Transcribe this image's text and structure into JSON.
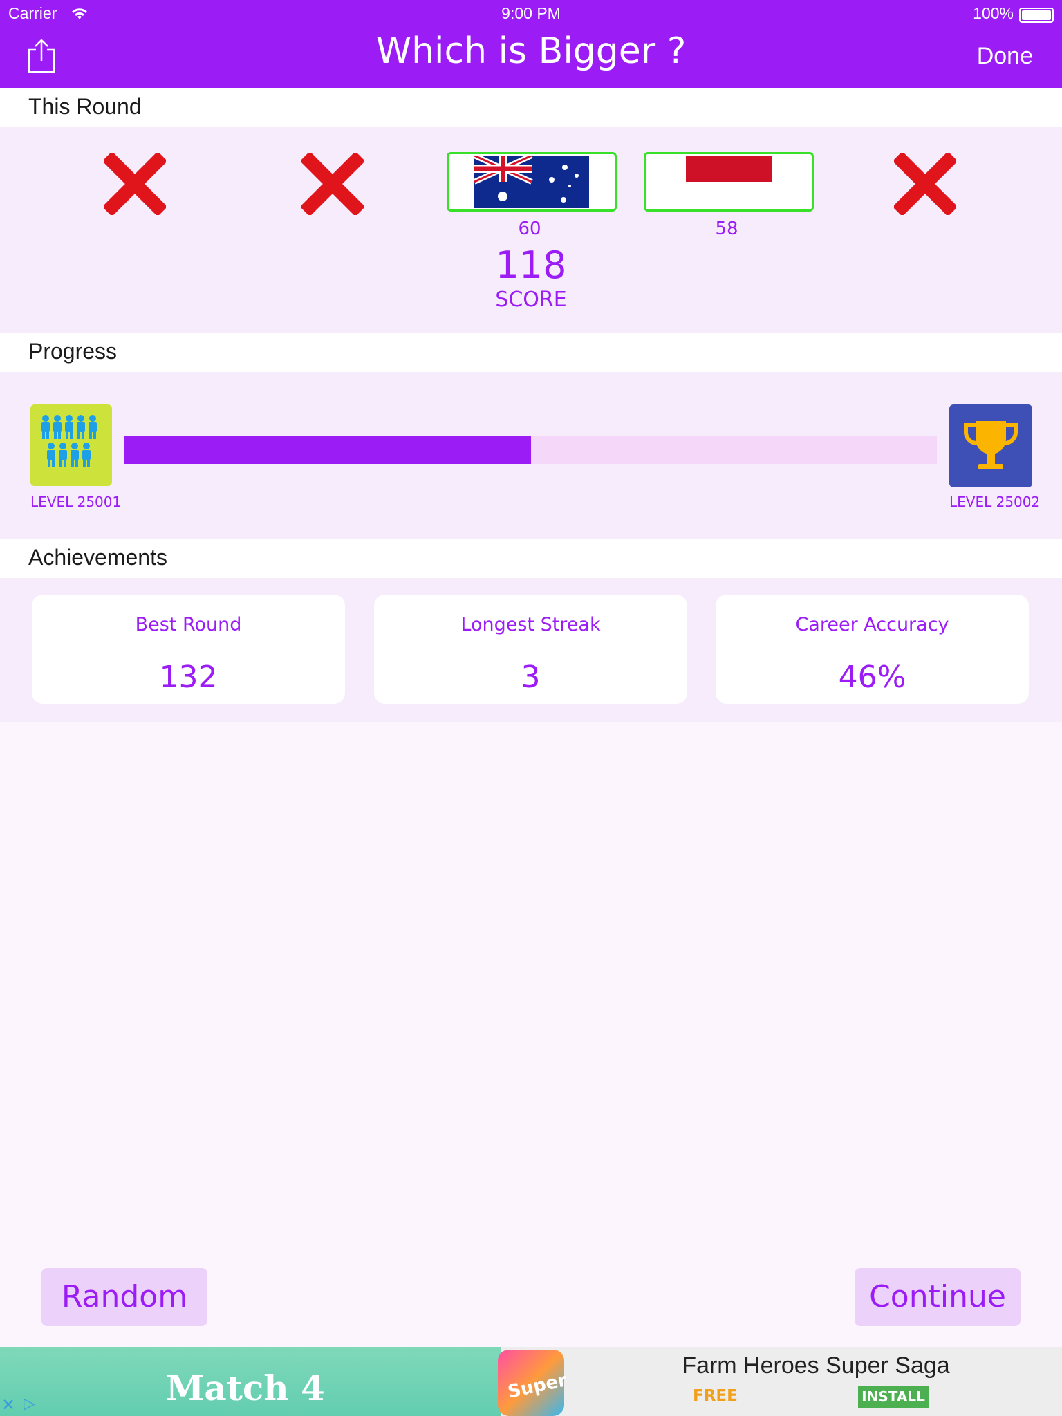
{
  "status_bar": {
    "carrier": "Carrier",
    "time": "9:00 PM",
    "battery": "100%"
  },
  "nav": {
    "title": "Which is Bigger ?",
    "done_label": "Done"
  },
  "this_round": {
    "heading": "This Round",
    "flags": [
      {
        "country": "Australia",
        "value": "60"
      },
      {
        "country": "Indonesia",
        "value": "58"
      }
    ],
    "score_value": "118",
    "score_label": "SCORE"
  },
  "progress": {
    "heading": "Progress",
    "current_level": "LEVEL 25001",
    "next_level": "LEVEL 25002",
    "fraction": 0.5
  },
  "achievements": {
    "heading": "Achievements",
    "cards": [
      {
        "title": "Best Round",
        "value": "132"
      },
      {
        "title": "Longest Streak",
        "value": "3"
      },
      {
        "title": "Career Accuracy",
        "value": "46%"
      }
    ]
  },
  "buttons": {
    "random": "Random",
    "continue": "Continue"
  },
  "ad": {
    "banner_text": "Match 4",
    "app_icon_text": "Super",
    "app_name": "Farm Heroes Super Saga",
    "price": "FREE",
    "install": "INSTALL"
  },
  "colors": {
    "accent": "#9b1cf5",
    "correct_border": "#38e02a",
    "wrong_mark": "#e0141b"
  }
}
